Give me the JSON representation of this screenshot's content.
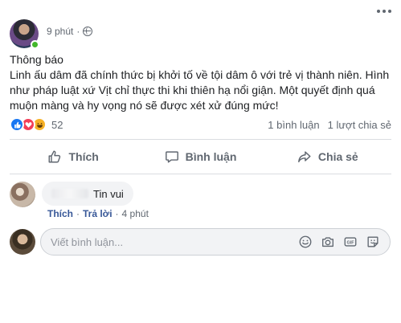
{
  "post": {
    "time": "9 phút",
    "separator": "·",
    "title": "Thông báo",
    "lines": [
      "Linh ấu dâm đã chính thức bị khởi tố về tội dâm ô với trẻ vị thành niên. Hình",
      "như pháp luật xứ Vịt chỉ thực thi khi thiên hạ nổi giận. Một quyết định quá",
      "muộn màng và hy vọng nó sẽ được xét xử đúng mức!"
    ]
  },
  "stats": {
    "reaction_count": "52",
    "comments": "1 bình luận",
    "shares": "1 lượt chia sẻ",
    "reaction_icons": [
      "like-icon",
      "love-icon",
      "haha-icon"
    ]
  },
  "actions": {
    "like": "Thích",
    "comment": "Bình luận",
    "share": "Chia sẻ"
  },
  "comment": {
    "text": "Tin vui",
    "like": "Thích",
    "reply": "Trả lời",
    "time": "4 phút",
    "separator": "·"
  },
  "compose": {
    "placeholder": "Viết bình luận..."
  },
  "colors": {
    "accent": "#1877f2",
    "link": "#385898",
    "muted": "#606770",
    "online": "#42b72a"
  }
}
